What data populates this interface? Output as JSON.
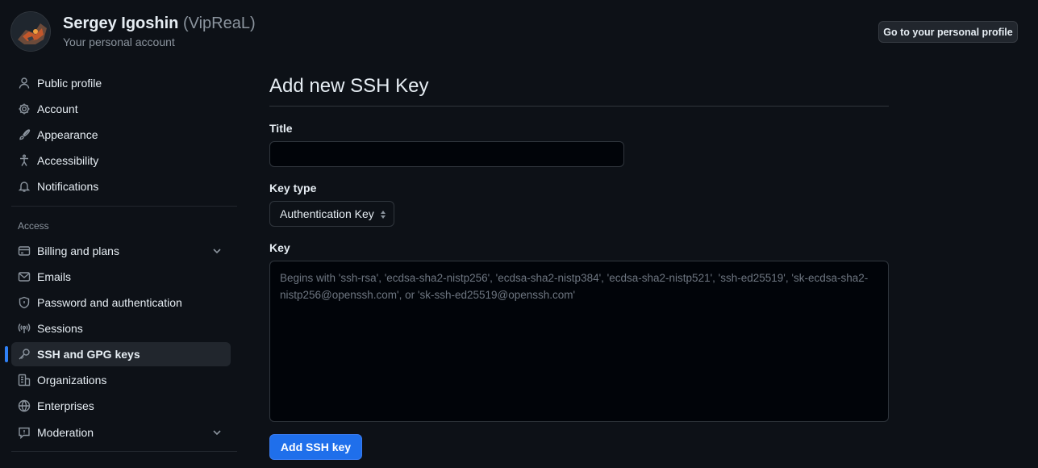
{
  "header": {
    "user_name": "Sergey Igoshin",
    "user_login": "(VipReaL)",
    "account_type": "Your personal account",
    "profile_button": "Go to your personal profile"
  },
  "sidebar": {
    "items": [
      {
        "label": "Public profile",
        "icon": "person-icon"
      },
      {
        "label": "Account",
        "icon": "gear-icon"
      },
      {
        "label": "Appearance",
        "icon": "paintbrush-icon"
      },
      {
        "label": "Accessibility",
        "icon": "accessibility-icon"
      },
      {
        "label": "Notifications",
        "icon": "bell-icon"
      }
    ],
    "access_label": "Access",
    "access_items": [
      {
        "label": "Billing and plans",
        "icon": "credit-card-icon",
        "expandable": true
      },
      {
        "label": "Emails",
        "icon": "mail-icon"
      },
      {
        "label": "Password and authentication",
        "icon": "shield-icon"
      },
      {
        "label": "Sessions",
        "icon": "broadcast-icon"
      },
      {
        "label": "SSH and GPG keys",
        "icon": "key-icon",
        "active": true
      },
      {
        "label": "Organizations",
        "icon": "organization-icon"
      },
      {
        "label": "Enterprises",
        "icon": "globe-icon"
      },
      {
        "label": "Moderation",
        "icon": "report-icon",
        "expandable": true
      }
    ]
  },
  "main": {
    "title": "Add new SSH Key",
    "title_field_label": "Title",
    "title_field_value": "",
    "key_type_label": "Key type",
    "key_type_value": "Authentication Key",
    "key_label": "Key",
    "key_placeholder": "Begins with 'ssh-rsa', 'ecdsa-sha2-nistp256', 'ecdsa-sha2-nistp384', 'ecdsa-sha2-nistp521', 'ssh-ed25519', 'sk-ecdsa-sha2-nistp256@openssh.com', or 'sk-ssh-ed25519@openssh.com'",
    "submit_label": "Add SSH key"
  },
  "colors": {
    "background": "#0d1117",
    "accent": "#2f81f7",
    "button_primary": "#1f6feb"
  }
}
